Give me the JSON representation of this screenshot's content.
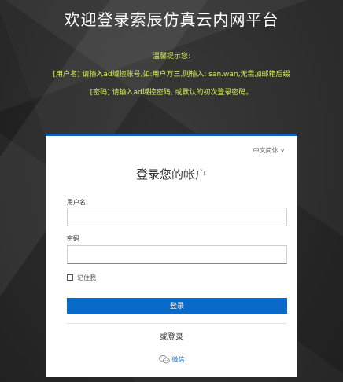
{
  "header": {
    "title": "欢迎登录索辰仿真云内网平台"
  },
  "notice": {
    "title": "温馨提示您:",
    "username_hint": "[用户名] 请输入ad域控账号,如:用户万三,则输入: san.wan,无需加邮箱后缀",
    "password_hint": "[密码] 请输入ad域控密码, 或默认的初次登录密码。"
  },
  "login": {
    "language": "中文简体 ∨",
    "title": "登录您的帐户",
    "username_label": "用户名",
    "username_value": "",
    "password_label": "密码",
    "password_value": "",
    "remember_label": "记住我",
    "remember_checked": false,
    "submit_label": "登录",
    "or_login": "或登录",
    "wechat_label": "微信"
  },
  "colors": {
    "accent": "#0a6ac9",
    "notice_text": "#d9ef5a",
    "card_border": "#1a5dbb"
  }
}
